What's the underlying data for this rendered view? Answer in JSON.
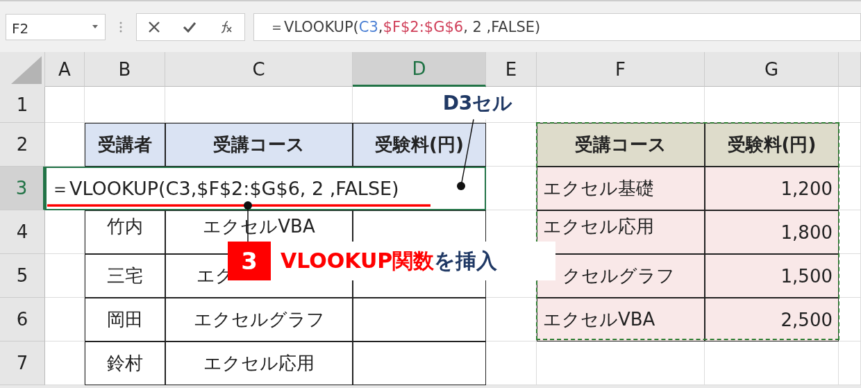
{
  "formula_bar": {
    "name_box": "F2",
    "segments": [
      {
        "text": "＝VLOOKUP(",
        "color": "#404040"
      },
      {
        "text": "C3",
        "color": "#4a7fd4"
      },
      {
        "text": ",",
        "color": "#404040"
      },
      {
        "text": "$F$2:$G$6",
        "color": "#d0405a"
      },
      {
        "text": ", 2 ,FALSE)",
        "color": "#404040"
      }
    ]
  },
  "columns": [
    {
      "label": "A",
      "selected": false
    },
    {
      "label": "B",
      "selected": false
    },
    {
      "label": "C",
      "selected": false
    },
    {
      "label": "D",
      "selected": true
    },
    {
      "label": "E",
      "selected": false
    },
    {
      "label": "F",
      "selected": false
    },
    {
      "label": "G",
      "selected": false
    }
  ],
  "rows": [
    {
      "label": "1",
      "selected": false
    },
    {
      "label": "2",
      "selected": false
    },
    {
      "label": "3",
      "selected": true
    },
    {
      "label": "4",
      "selected": false
    },
    {
      "label": "5",
      "selected": false
    },
    {
      "label": "6",
      "selected": false
    },
    {
      "label": "7",
      "selected": false
    }
  ],
  "left_table": {
    "headers": [
      "受講者",
      "受講コース",
      "受験料(円)"
    ],
    "rows": [
      {
        "name": "竹内",
        "course": "エクセルVBA"
      },
      {
        "name": "三宅",
        "course": "エク"
      },
      {
        "name": "岡田",
        "course": "エクセルグラフ"
      },
      {
        "name": "鈴村",
        "course": "エクセル応用"
      }
    ]
  },
  "formula_cell": {
    "text": "＝VLOOKUP(C3,$F$2:$G$6, 2 ,FALSE)"
  },
  "lookup_table": {
    "headers": [
      "受講コース",
      "受験料(円)"
    ],
    "rows": [
      {
        "course": "エクセル基礎",
        "fee": "1,200"
      },
      {
        "course": "エクセル応用",
        "fee": "1,800"
      },
      {
        "course": "クセルグラフ",
        "fee": "1,500"
      },
      {
        "course": "エクセルVBA",
        "fee": "2,500"
      }
    ]
  },
  "callouts": [
    {
      "kind": "label",
      "text": "D3セル"
    },
    {
      "kind": "step",
      "number": "3",
      "parts": [
        {
          "text": "VLOOKUP関数",
          "color": "#ff0000"
        },
        {
          "text": "を挿入",
          "color": "#1f3864"
        }
      ]
    }
  ]
}
